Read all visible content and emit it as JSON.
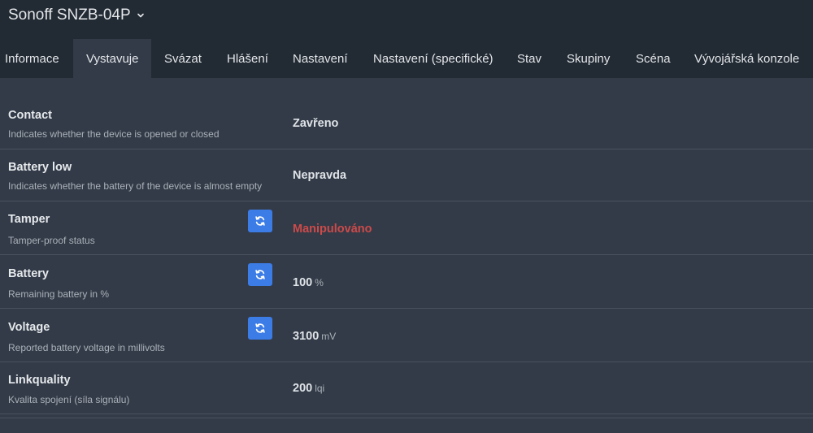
{
  "header": {
    "device_name": "Sonoff SNZB-04P"
  },
  "tabs": [
    {
      "label": "Informace"
    },
    {
      "label": "Vystavuje"
    },
    {
      "label": "Svázat"
    },
    {
      "label": "Hlášení"
    },
    {
      "label": "Nastavení"
    },
    {
      "label": "Nastavení (specifické)"
    },
    {
      "label": "Stav"
    },
    {
      "label": "Skupiny"
    },
    {
      "label": "Scéna"
    },
    {
      "label": "Vývojářská konzole"
    }
  ],
  "exposes": [
    {
      "label": "Contact",
      "description": "Indicates whether the device is opened or closed",
      "value": "Zavřeno",
      "unit": ""
    },
    {
      "label": "Battery low",
      "description": "Indicates whether the battery of the device is almost empty",
      "value": "Nepravda",
      "unit": ""
    },
    {
      "label": "Tamper",
      "description": "Tamper-proof status",
      "value": "Manipulováno",
      "unit": ""
    },
    {
      "label": "Battery",
      "description": "Remaining battery in %",
      "value": "100",
      "unit": "%"
    },
    {
      "label": "Voltage",
      "description": "Reported battery voltage in millivolts",
      "value": "3100",
      "unit": "mV"
    },
    {
      "label": "Linkquality",
      "description": "Kvalita spojení (síla signálu)",
      "value": "200",
      "unit": "lqi"
    }
  ],
  "colors": {
    "header_bg": "#222a33",
    "page_bg": "#333b48",
    "accent_button": "#3c7ce6",
    "tamper_value": "#cd4a4a"
  }
}
